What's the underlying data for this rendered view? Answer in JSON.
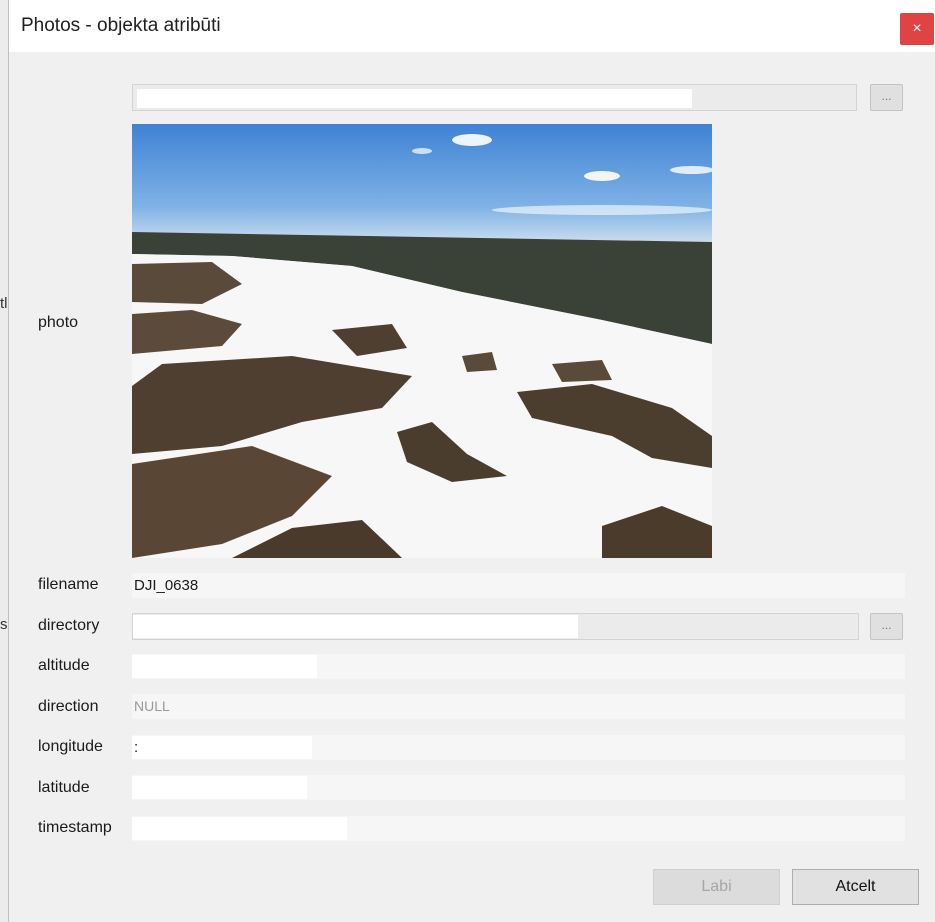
{
  "window": {
    "title": "Photos - objekta atribūti",
    "close_glyph": "×"
  },
  "background_glyphs": [
    "tl",
    "s'"
  ],
  "photo": {
    "label": "photo",
    "browse_label": "...",
    "image_icon": "aerial-snow-bog-photo",
    "sky_color": "#4f8fd8",
    "snow_color": "#fafafa",
    "forest_color": "#3a4136"
  },
  "fields": {
    "filename": {
      "label": "filename",
      "value": "DJI_0638"
    },
    "directory": {
      "label": "directory",
      "value": "",
      "browse_label": "..."
    },
    "altitude": {
      "label": "altitude",
      "value": ""
    },
    "direction": {
      "label": "direction",
      "value": "NULL"
    },
    "longitude": {
      "label": "longitude",
      "value": ":"
    },
    "latitude": {
      "label": "latitude",
      "value": ""
    },
    "timestamp": {
      "label": "timestamp",
      "value": ""
    }
  },
  "buttons": {
    "ok_label": "Labi",
    "cancel_label": "Atcelt"
  },
  "colors": {
    "close": "#e04343",
    "disabled_text": "#a6a6a6"
  }
}
